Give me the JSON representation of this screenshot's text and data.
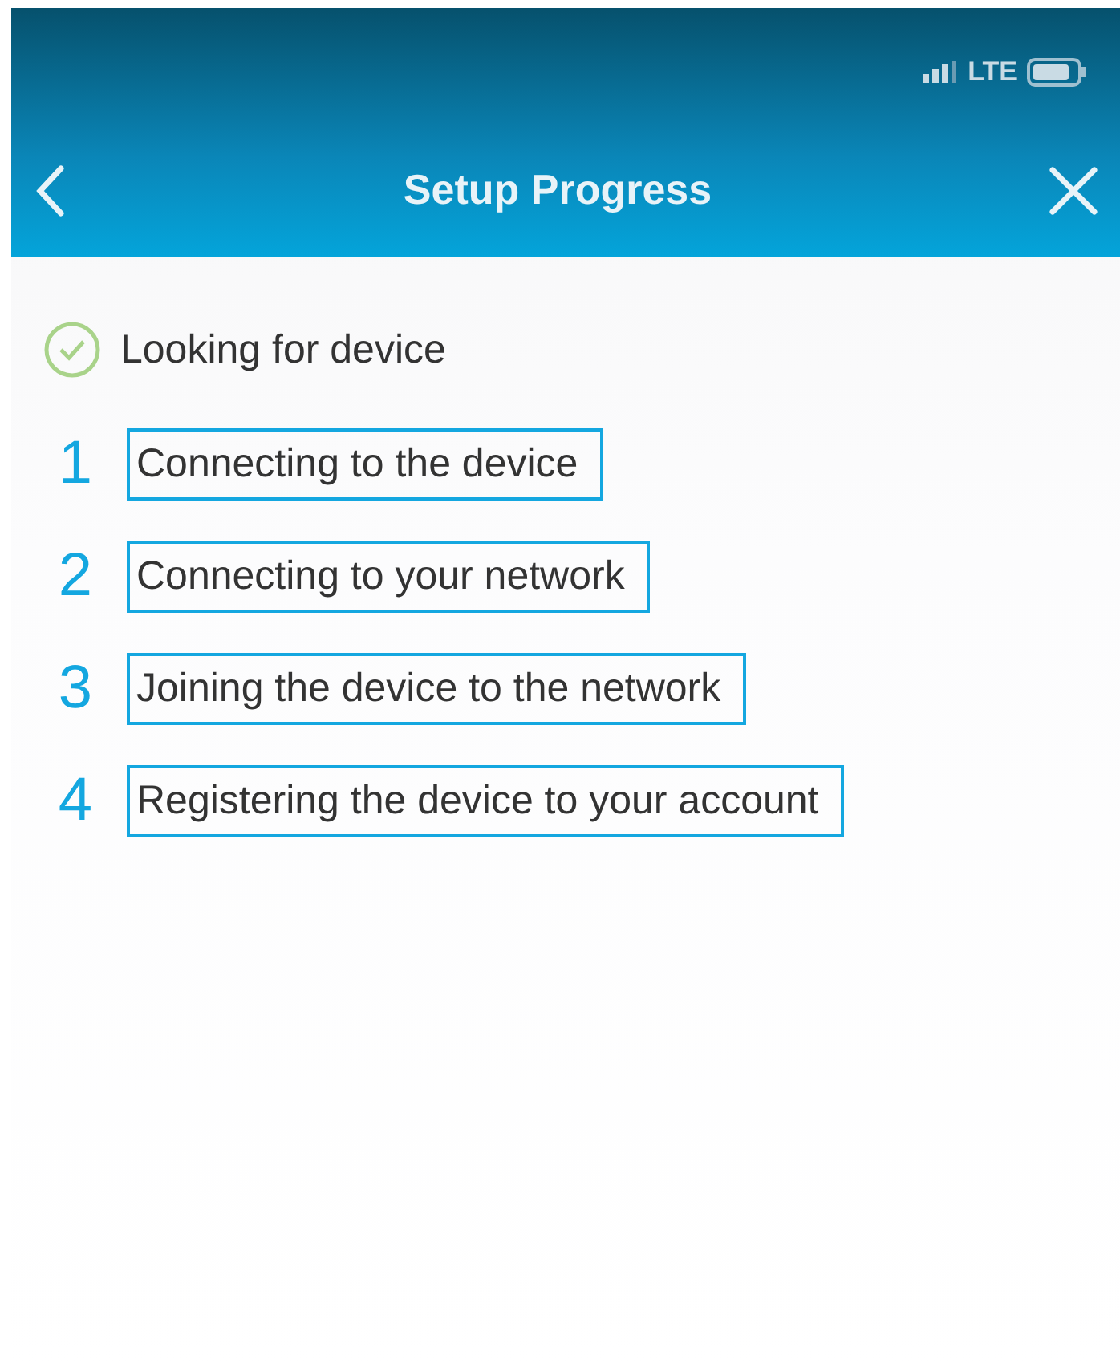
{
  "status_bar": {
    "network": "LTE"
  },
  "nav": {
    "title": "Setup Progress"
  },
  "steps": [
    {
      "kind": "done",
      "label": "Looking for device"
    },
    {
      "kind": "annotated",
      "number": "1",
      "label": "Connecting to the device"
    },
    {
      "kind": "annotated",
      "number": "2",
      "label": "Connecting to your network"
    },
    {
      "kind": "annotated",
      "number": "3",
      "label": "Joining the device to the network"
    },
    {
      "kind": "annotated",
      "number": "4",
      "label": "Registering the device to your account"
    }
  ]
}
